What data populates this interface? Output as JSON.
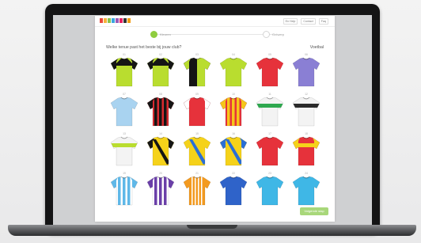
{
  "brand": {
    "logo_colors": [
      "#e8463a",
      "#f6b23c",
      "#8bc34a",
      "#3aa7e0",
      "#9b59b6",
      "#e91e63",
      "#333333",
      "#f39c12"
    ]
  },
  "header": {
    "nav_links": [
      "En Help",
      "Contact",
      "Faq"
    ]
  },
  "steps": {
    "step1_label": "Kleuren",
    "step2_label": "Ontwerp"
  },
  "main": {
    "instruction": "Welke tenue past het beste bij jouw club?",
    "max_label": "Voetbal"
  },
  "jerseys": [
    {
      "number": "01",
      "icon": "jersey-icon",
      "body": "#b9dd2f",
      "sleeve": "#151515",
      "accent": "#151515",
      "pattern": "shoulder"
    },
    {
      "number": "02",
      "icon": "jersey-icon",
      "body": "#b9dd2f",
      "sleeve": "#151515",
      "accent": "#151515",
      "pattern": "shoulder"
    },
    {
      "number": "03",
      "icon": "jersey-icon",
      "body": "#151515",
      "sleeve": "#b9dd2f",
      "accent": "#b9dd2f",
      "pattern": "split"
    },
    {
      "number": "04",
      "icon": "jersey-icon",
      "body": "#b9dd2f",
      "sleeve": "#b9dd2f",
      "accent": "#9cc41f",
      "pattern": "plain"
    },
    {
      "number": "05",
      "icon": "jersey-icon",
      "body": "#e6323b",
      "sleeve": "#e6323b",
      "accent": "#c41e28",
      "pattern": "plain"
    },
    {
      "number": "06",
      "icon": "jersey-icon",
      "body": "#8a7fd4",
      "sleeve": "#8a7fd4",
      "accent": "#6d62bf",
      "pattern": "plain"
    },
    {
      "number": "07",
      "icon": "jersey-icon",
      "body": "#a9d3f0",
      "sleeve": "#a9d3f0",
      "accent": "#7fbbe3",
      "pattern": "plain"
    },
    {
      "number": "08",
      "icon": "jersey-icon",
      "body": "#d92a2f",
      "sleeve": "#151515",
      "accent": "#151515",
      "pattern": "stripes"
    },
    {
      "number": "09",
      "icon": "jersey-icon",
      "body": "#e6323b",
      "sleeve": "#ffffff",
      "accent": "#ffffff",
      "pattern": "plain"
    },
    {
      "number": "10",
      "icon": "jersey-icon",
      "body": "#e6323b",
      "sleeve": "#f5c61a",
      "accent": "#f5c61a",
      "pattern": "stripes"
    },
    {
      "number": "11",
      "icon": "jersey-icon",
      "body": "#f3f3f3",
      "sleeve": "#f3f3f3",
      "accent": "#2fa84f",
      "pattern": "band"
    },
    {
      "number": "12",
      "icon": "jersey-icon",
      "body": "#f3f3f3",
      "sleeve": "#f3f3f3",
      "accent": "#2a2a2a",
      "pattern": "band"
    },
    {
      "number": "13",
      "icon": "jersey-icon",
      "body": "#f3f3f3",
      "sleeve": "#f3f3f3",
      "accent": "#b9dd2f",
      "pattern": "band"
    },
    {
      "number": "14",
      "icon": "jersey-icon",
      "body": "#f5d21a",
      "sleeve": "#151515",
      "accent": "#151515",
      "pattern": "sash"
    },
    {
      "number": "15",
      "icon": "jersey-icon",
      "body": "#f5d21a",
      "sleeve": "#f5d21a",
      "accent": "#2a6fd6",
      "pattern": "sash"
    },
    {
      "number": "16",
      "icon": "jersey-icon",
      "body": "#f5d21a",
      "sleeve": "#2a6fd6",
      "accent": "#2a6fd6",
      "pattern": "sash"
    },
    {
      "number": "17",
      "icon": "jersey-icon",
      "body": "#e6323b",
      "sleeve": "#e6323b",
      "accent": "#ffffff",
      "pattern": "plain"
    },
    {
      "number": "18",
      "icon": "jersey-icon",
      "body": "#e6323b",
      "sleeve": "#f5d21a",
      "accent": "#f5d21a",
      "pattern": "band"
    },
    {
      "number": "19",
      "icon": "jersey-icon",
      "body": "#ffffff",
      "sleeve": "#5fb8e8",
      "accent": "#5fb8e8",
      "pattern": "stripes"
    },
    {
      "number": "20",
      "icon": "jersey-icon",
      "body": "#ffffff",
      "sleeve": "#6a3fa8",
      "accent": "#6a3fa8",
      "pattern": "stripes"
    },
    {
      "number": "21",
      "icon": "jersey-icon",
      "body": "#f39a1f",
      "sleeve": "#f39a1f",
      "accent": "#ffffff",
      "pattern": "thinstripes"
    },
    {
      "number": "22",
      "icon": "jersey-icon",
      "body": "#2f63c9",
      "sleeve": "#2f63c9",
      "accent": "#244fa6",
      "pattern": "plain"
    },
    {
      "number": "23",
      "icon": "jersey-icon",
      "body": "#3fb7e6",
      "sleeve": "#3fb7e6",
      "accent": "#2aa0d1",
      "pattern": "plain"
    },
    {
      "number": "24",
      "icon": "jersey-icon",
      "body": "#3fb7e6",
      "sleeve": "#3fb7e6",
      "accent": "#2aa0d1",
      "pattern": "plain"
    }
  ],
  "footer": {
    "next_button": "Volgende stap"
  }
}
